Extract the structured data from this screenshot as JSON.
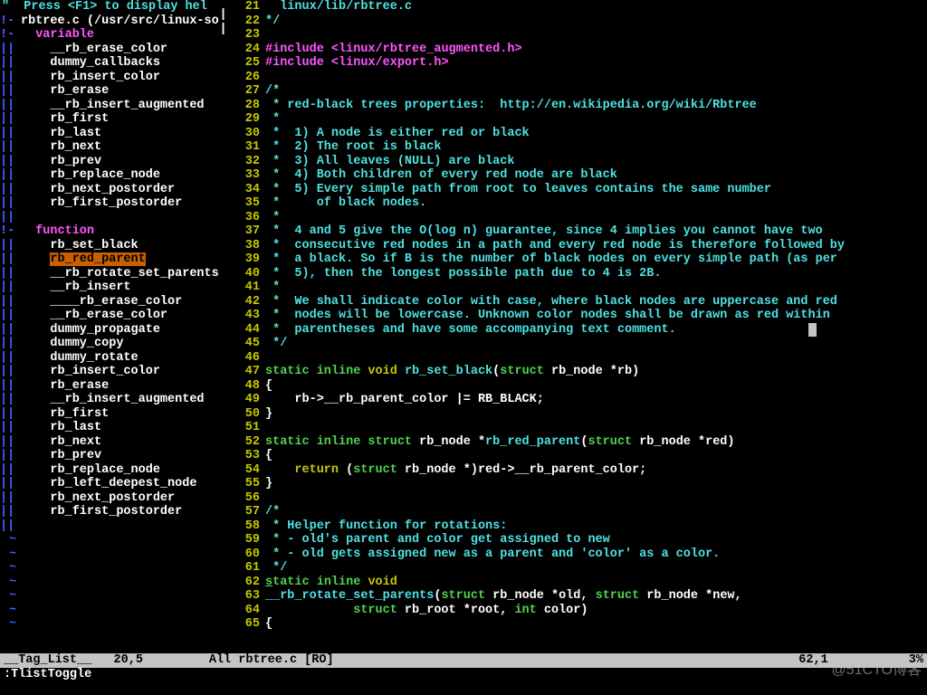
{
  "help_hint": "\"  Press <F1> to display hel",
  "tag_file": "rbtree.c (/usr/src/linux-so",
  "sections": [
    {
      "label": "variable",
      "fold": "!-",
      "items": [
        {
          "t": "__rb_erase_color"
        },
        {
          "t": "dummy_callbacks"
        },
        {
          "t": "rb_insert_color"
        },
        {
          "t": "rb_erase"
        },
        {
          "t": "__rb_insert_augmented"
        },
        {
          "t": "rb_first"
        },
        {
          "t": "rb_last"
        },
        {
          "t": "rb_next"
        },
        {
          "t": "rb_prev"
        },
        {
          "t": "rb_replace_node"
        },
        {
          "t": "rb_next_postorder"
        },
        {
          "t": "rb_first_postorder"
        }
      ]
    },
    {
      "label": "function",
      "fold": "!-",
      "items": [
        {
          "t": "rb_set_black"
        },
        {
          "t": "rb_red_parent",
          "hl": true
        },
        {
          "t": "__rb_rotate_set_parents"
        },
        {
          "t": "__rb_insert"
        },
        {
          "t": "____rb_erase_color"
        },
        {
          "t": "__rb_erase_color"
        },
        {
          "t": "dummy_propagate"
        },
        {
          "t": "dummy_copy"
        },
        {
          "t": "dummy_rotate"
        },
        {
          "t": "rb_insert_color"
        },
        {
          "t": "rb_erase"
        },
        {
          "t": "__rb_insert_augmented"
        },
        {
          "t": "rb_first"
        },
        {
          "t": "rb_last"
        },
        {
          "t": "rb_next"
        },
        {
          "t": "rb_prev"
        },
        {
          "t": "rb_replace_node"
        },
        {
          "t": "rb_left_deepest_node"
        },
        {
          "t": "rb_next_postorder"
        },
        {
          "t": "rb_first_postorder"
        }
      ]
    }
  ],
  "code": {
    "start": 21,
    "lines": [
      {
        "n": 21,
        "seg": [
          [
            "cmt",
            "  linux/lib/rbtree.c"
          ]
        ]
      },
      {
        "n": 22,
        "seg": [
          [
            "cmt",
            "*/"
          ]
        ]
      },
      {
        "n": 23,
        "seg": []
      },
      {
        "n": 24,
        "seg": [
          [
            "inc",
            "#include "
          ],
          [
            "cstr",
            "<linux/rbtree_augmented.h>"
          ]
        ]
      },
      {
        "n": 25,
        "seg": [
          [
            "inc",
            "#include "
          ],
          [
            "cstr",
            "<linux/export.h>"
          ]
        ]
      },
      {
        "n": 26,
        "seg": []
      },
      {
        "n": 27,
        "seg": [
          [
            "cmt",
            "/*"
          ]
        ]
      },
      {
        "n": 28,
        "seg": [
          [
            "cmt",
            " * red-black trees properties:  http://en.wikipedia.org/wiki/Rbtree"
          ]
        ]
      },
      {
        "n": 29,
        "seg": [
          [
            "cmt",
            " *"
          ]
        ]
      },
      {
        "n": 30,
        "seg": [
          [
            "cmt",
            " *  1) A node is either red or black"
          ]
        ]
      },
      {
        "n": 31,
        "seg": [
          [
            "cmt",
            " *  2) The root is black"
          ]
        ]
      },
      {
        "n": 32,
        "seg": [
          [
            "cmt",
            " *  3) All leaves (NULL) are black"
          ]
        ]
      },
      {
        "n": 33,
        "seg": [
          [
            "cmt",
            " *  4) Both children of every red node are black"
          ]
        ]
      },
      {
        "n": 34,
        "seg": [
          [
            "cmt",
            " *  5) Every simple path from root to leaves contains the same number"
          ]
        ]
      },
      {
        "n": 35,
        "seg": [
          [
            "cmt",
            " *     of black nodes."
          ]
        ]
      },
      {
        "n": 36,
        "seg": [
          [
            "cmt",
            " *"
          ]
        ]
      },
      {
        "n": 37,
        "seg": [
          [
            "cmt",
            " *  4 and 5 give the O(log n) guarantee, since 4 implies you cannot have two"
          ]
        ]
      },
      {
        "n": 38,
        "seg": [
          [
            "cmt",
            " *  consecutive red nodes in a path and every red node is therefore followed by"
          ]
        ]
      },
      {
        "n": 39,
        "seg": [
          [
            "cmt",
            " *  a black. So if B is the number of black nodes on every simple path (as per"
          ]
        ]
      },
      {
        "n": 40,
        "seg": [
          [
            "cmt",
            " *  5), then the longest possible path due to 4 is 2B."
          ]
        ]
      },
      {
        "n": 41,
        "seg": [
          [
            "cmt",
            " *"
          ]
        ]
      },
      {
        "n": 42,
        "seg": [
          [
            "cmt",
            " *  We shall indicate color with case, where black nodes are uppercase and red"
          ]
        ]
      },
      {
        "n": 43,
        "seg": [
          [
            "cmt",
            " *  nodes will be lowercase. Unknown color nodes shall be drawn as red within"
          ]
        ]
      },
      {
        "n": 44,
        "seg": [
          [
            "cmt",
            " *  parentheses and have some accompanying text comment.                  "
          ],
          [
            "cur",
            ""
          ]
        ]
      },
      {
        "n": 45,
        "seg": [
          [
            "cmt",
            " */"
          ]
        ]
      },
      {
        "n": 46,
        "seg": []
      },
      {
        "n": 47,
        "seg": [
          [
            "ty",
            "static inline "
          ],
          [
            "kw",
            "void"
          ],
          [
            "pl",
            " "
          ],
          [
            "id",
            "rb_set_black"
          ],
          [
            "pl",
            "("
          ],
          [
            "ty",
            "struct"
          ],
          [
            "pl",
            " rb_node *rb)"
          ]
        ]
      },
      {
        "n": 48,
        "seg": [
          [
            "pl",
            "{"
          ]
        ]
      },
      {
        "n": 49,
        "seg": [
          [
            "pl",
            "    rb->__rb_parent_color |= RB_BLACK;"
          ]
        ]
      },
      {
        "n": 50,
        "seg": [
          [
            "pl",
            "}"
          ]
        ]
      },
      {
        "n": 51,
        "seg": []
      },
      {
        "n": 52,
        "seg": [
          [
            "ty",
            "static inline struct"
          ],
          [
            "pl",
            " rb_node *"
          ],
          [
            "id",
            "rb_red_parent"
          ],
          [
            "pl",
            "("
          ],
          [
            "ty",
            "struct"
          ],
          [
            "pl",
            " rb_node *red)"
          ]
        ]
      },
      {
        "n": 53,
        "seg": [
          [
            "pl",
            "{"
          ]
        ]
      },
      {
        "n": 54,
        "seg": [
          [
            "pl",
            "    "
          ],
          [
            "kw",
            "return"
          ],
          [
            "pl",
            " ("
          ],
          [
            "ty",
            "struct"
          ],
          [
            "pl",
            " rb_node *)red->__rb_parent_color;"
          ]
        ]
      },
      {
        "n": 55,
        "seg": [
          [
            "pl",
            "}"
          ]
        ]
      },
      {
        "n": 56,
        "seg": []
      },
      {
        "n": 57,
        "seg": [
          [
            "cmt",
            "/*"
          ]
        ]
      },
      {
        "n": 58,
        "seg": [
          [
            "cmt",
            " * Helper function for rotations:"
          ]
        ]
      },
      {
        "n": 59,
        "seg": [
          [
            "cmt",
            " * - old's parent and color get assigned to new"
          ]
        ]
      },
      {
        "n": 60,
        "seg": [
          [
            "cmt",
            " * - old gets assigned new as a parent and 'color' as a color."
          ]
        ]
      },
      {
        "n": 61,
        "seg": [
          [
            "cmt",
            " */"
          ]
        ]
      },
      {
        "n": 62,
        "seg": [
          [
            "tyul",
            "s"
          ],
          [
            "ty",
            "tatic inline "
          ],
          [
            "kw",
            "void"
          ]
        ]
      },
      {
        "n": 63,
        "seg": [
          [
            "id",
            "__rb_rotate_set_parents"
          ],
          [
            "pl",
            "("
          ],
          [
            "ty",
            "struct"
          ],
          [
            "pl",
            " rb_node *old, "
          ],
          [
            "ty",
            "struct"
          ],
          [
            "pl",
            " rb_node *new,"
          ]
        ]
      },
      {
        "n": 64,
        "seg": [
          [
            "pl",
            "            "
          ],
          [
            "ty",
            "struct"
          ],
          [
            "pl",
            " rb_root *root, "
          ],
          [
            "ty",
            "int"
          ],
          [
            "pl",
            " color)"
          ]
        ]
      },
      {
        "n": 65,
        "seg": [
          [
            "pl",
            "{"
          ]
        ]
      }
    ]
  },
  "status_left": "__Tag_List__   20,5         All",
  "status_right_file": " rbtree.c [RO]",
  "status_right_pos": "62,1           3%",
  "cmd": ":TlistToggle",
  "watermark": "@51CTO博客"
}
